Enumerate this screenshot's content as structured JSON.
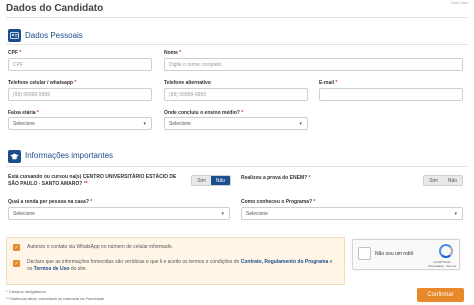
{
  "header": {
    "title": "Dados do Candidato",
    "top_right": "Saiba Mais"
  },
  "section_personal": {
    "title": "Dados Pessoais",
    "icon": "id-card-icon"
  },
  "fields": {
    "cpf": {
      "label": "CPF",
      "placeholder": "CPF"
    },
    "nome": {
      "label": "Nome",
      "placeholder": "Digite o nome completo"
    },
    "celular": {
      "label": "Telefone celular / whatsapp",
      "placeholder": "(99) 99999-9999"
    },
    "alternativo": {
      "label": "Telefone alternativo",
      "placeholder": "(99) 99999-9999"
    },
    "email": {
      "label": "E-mail"
    },
    "faixa": {
      "label": "Faixa etária",
      "value": "Selecione"
    },
    "ensino": {
      "label": "Onde concluiu o ensino médio?",
      "value": "Selecione"
    }
  },
  "section_info": {
    "title": "Informações importantes",
    "icon": "graduation-cap-icon"
  },
  "questions": {
    "cursando_line1": "Está cursando ou cursou na(s) CENTRO UNIVERSITÁRIO ESTÁCIO DE",
    "cursando_line2": "SÃO PAULO - SANTO AMARO?",
    "cursando_yes": "Sim",
    "cursando_no": "Não",
    "enem": "Realizou a prova do ENEM?",
    "enem_yes": "Sim",
    "enem_no": "Não",
    "renda": {
      "label": "Qual a renda per pessoa na casa?",
      "value": "Selecione"
    },
    "conheceu": {
      "label": "Como conheceu o Programa?",
      "value": "Selecione"
    }
  },
  "consent": {
    "whatsapp": "Autorizo o contato via WhatsApp no número de celular informado.",
    "declaro_prefix": "Declaro que as informações fornecidas são verídicas e que li e aceito os termos e condições do",
    "link_contrato": "Contrato, Regulamento do Programa",
    "declaro_middle": "e os",
    "link_termos": "Termos de Uso",
    "declaro_suffix": "do site."
  },
  "recaptcha": {
    "label": "Não sou um robô",
    "brand_line1": "reCAPTCHA",
    "brand_line2": "Privacidade - Termos"
  },
  "notes": {
    "required": "Campos obrigatórios",
    "enrolled": "Matrícula ativa, cancelada ou trancada na Faculdade"
  },
  "actions": {
    "confirm": "Confirmar"
  },
  "colors": {
    "primary": "#1c4d8c",
    "accent": "#e8892b",
    "required": "#d03030"
  }
}
